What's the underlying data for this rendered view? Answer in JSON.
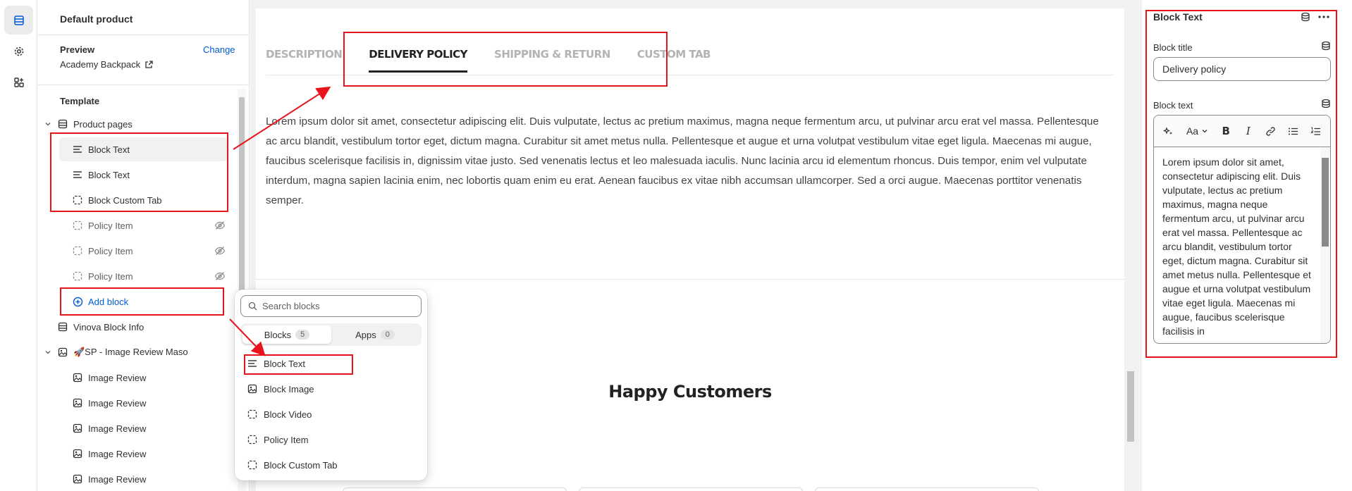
{
  "left_panel": {
    "title": "Default product",
    "preview_label": "Preview",
    "change_label": "Change",
    "preview_product": "Academy Backpack",
    "template_label": "Template",
    "tree": [
      {
        "label": "Product pages",
        "icon": "section-icon"
      },
      {
        "label": "Block Text",
        "icon": "text-lines-icon",
        "selected": true
      },
      {
        "label": "Block Text",
        "icon": "text-lines-icon"
      },
      {
        "label": "Block Custom Tab",
        "icon": "dashed-square-icon"
      },
      {
        "label": "Policy Item",
        "icon": "dashed-square-icon",
        "hidden": true
      },
      {
        "label": "Policy Item",
        "icon": "dashed-square-icon",
        "hidden": true
      },
      {
        "label": "Policy Item",
        "icon": "dashed-square-icon",
        "hidden": true
      },
      {
        "label": "Add block",
        "icon": "plus-circle-icon"
      },
      {
        "label": "Vinova Block Info",
        "icon": "section-icon"
      },
      {
        "label": "🚀SP - Image Review Maso",
        "icon": "image-section-icon"
      },
      {
        "label": "Image Review",
        "icon": "image-icon"
      },
      {
        "label": "Image Review",
        "icon": "image-icon"
      },
      {
        "label": "Image Review",
        "icon": "image-icon"
      },
      {
        "label": "Image Review",
        "icon": "image-icon"
      },
      {
        "label": "Image Review",
        "icon": "image-icon"
      }
    ]
  },
  "preview": {
    "tabs": [
      "DESCRIPTION",
      "DELIVERY POLICY",
      "SHIPPING & RETURN",
      "CUSTOM TAB"
    ],
    "active_tab": "DELIVERY POLICY",
    "body_text": "Lorem ipsum dolor sit amet, consectetur adipiscing elit. Duis vulputate, lectus ac pretium maximus, magna neque fermentum arcu, ut pulvinar arcu erat vel massa. Pellentesque ac arcu blandit, vestibulum tortor eget, dictum magna. Curabitur sit amet metus nulla. Pellentesque et augue et urna volutpat vestibulum vitae eget ligula. Maecenas mi augue, faucibus scelerisque facilisis in, dignissim vitae justo. Sed venenatis lectus et leo malesuada iaculis. Nunc lacinia arcu id elementum rhoncus. Duis tempor, enim vel vulputate interdum, magna sapien lacinia enim, nec lobortis quam enim eu erat. Aenean faucibus ex vitae nibh accumsan ullamcorper. Sed a orci augue. Maecenas porttitor venenatis semper.",
    "section_heading": "Happy Customers"
  },
  "popup": {
    "search_placeholder": "Search blocks",
    "tab_blocks": "Blocks",
    "tab_blocks_count": "5",
    "tab_apps": "Apps",
    "tab_apps_count": "0",
    "items": [
      {
        "label": "Block Text",
        "icon": "text-lines-icon"
      },
      {
        "label": "Block Image",
        "icon": "image-icon"
      },
      {
        "label": "Block Video",
        "icon": "dashed-square-icon"
      },
      {
        "label": "Policy Item",
        "icon": "dashed-square-icon"
      },
      {
        "label": "Block Custom Tab",
        "icon": "dashed-square-icon"
      }
    ]
  },
  "right_panel": {
    "title": "Block Text",
    "block_title_label": "Block title",
    "block_title_value": "Delivery policy",
    "block_text_label": "Block text",
    "toolbar_font": "Aa",
    "block_text_value": "Lorem ipsum dolor sit amet, consectetur adipiscing elit. Duis vulputate, lectus ac pretium maximus, magna neque fermentum arcu, ut pulvinar arcu erat vel massa. Pellentesque ac arcu blandit, vestibulum tortor eget, dictum magna. Curabitur sit amet metus nulla. Pellentesque et augue et urna volutpat vestibulum vitae eget ligula. Maecenas mi augue, faucibus scelerisque facilisis in"
  },
  "colors": {
    "link": "#005bd3",
    "annotation": "#e8141b",
    "active_tab": "#222222",
    "inactive_tab": "#b3b3b3"
  }
}
